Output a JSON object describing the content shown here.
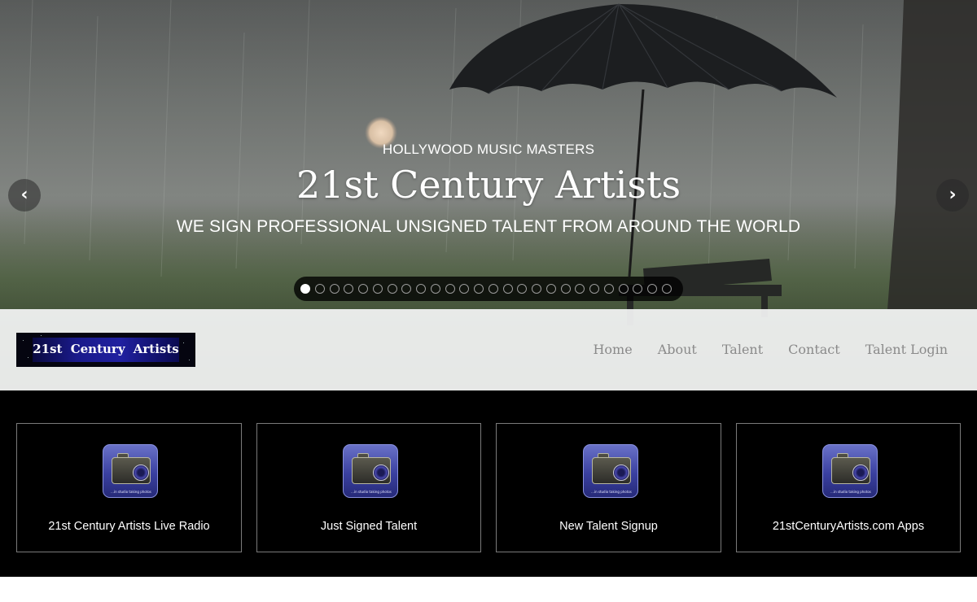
{
  "hero": {
    "kicker": "HOLLYWOOD MUSIC MASTERS",
    "title": "21st Century Artists",
    "tagline": "WE SIGN PROFESSIONAL UNSIGNED TALENT FROM AROUND THE WORLD",
    "prev_icon": "chevron-left-icon",
    "next_icon": "chevron-right-icon",
    "slide_count": 26,
    "active_slide": 1
  },
  "nav": {
    "logo_text": "21st Century Artists",
    "links": [
      "Home",
      "About",
      "Talent",
      "Contact",
      "Talent Login"
    ]
  },
  "features": {
    "cards": [
      {
        "label": "21st Century Artists Live Radio",
        "icon": "camera-icon",
        "icon_caption": "...in studio taking photos"
      },
      {
        "label": "Just Signed Talent",
        "icon": "camera-icon",
        "icon_caption": "...in studio taking photos"
      },
      {
        "label": "New Talent Signup",
        "icon": "camera-icon",
        "icon_caption": "...in studio taking photos"
      },
      {
        "label": "21stCenturyArtists.com Apps",
        "icon": "camera-icon",
        "icon_caption": "...in studio taking photos"
      }
    ]
  },
  "colors": {
    "features_bg": "#000000",
    "nav_bg": "#f4f5f5",
    "nav_link": "#8a8a8a",
    "card_border": "#7a7a7a"
  }
}
